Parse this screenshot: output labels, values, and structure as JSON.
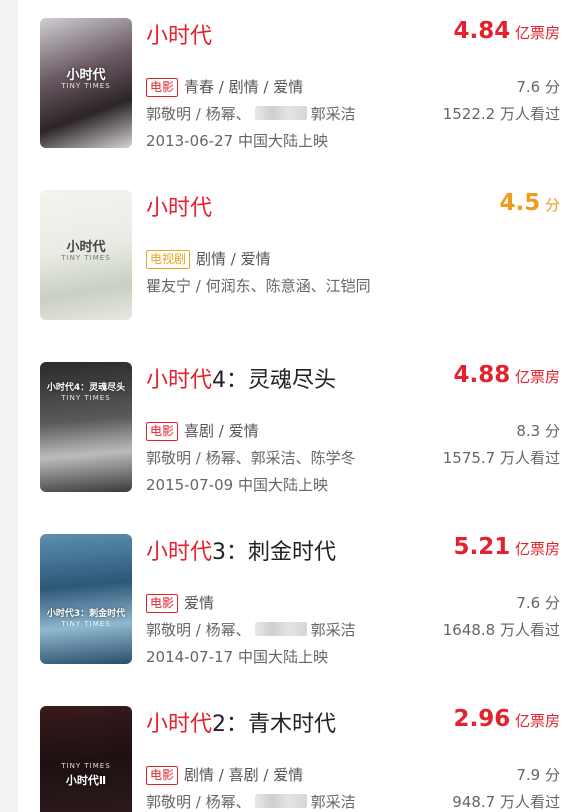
{
  "colors": {
    "accent_red": "#e2222e",
    "accent_orange": "#f29a1d",
    "tag_orange": "#e8a31f"
  },
  "items": [
    {
      "title_brand": "小时代",
      "title_rest": "",
      "figure_value": "4.84",
      "figure_unit": "亿票房",
      "tag": "电影",
      "genres": "青春 / 剧情 / 爱情",
      "cast_a": "郭敬明 / 杨幂、",
      "cast_b": "郭采洁",
      "release": "2013-06-27 中国大陆上映",
      "score": "7.6 分",
      "watched": "1522.2 万人看过",
      "poster_title": "小时代",
      "poster_sub": "TINY TIMES"
    },
    {
      "title_brand": "小时代",
      "title_rest": "",
      "figure_value": "4.5",
      "figure_unit": "分",
      "tag": "电视剧",
      "genres": "剧情 / 爱情",
      "cast": "瞿友宁 / 何润东、陈意涵、江铠同",
      "poster_title": "小时代",
      "poster_sub": "TINY TIMES"
    },
    {
      "title_brand": "小时代",
      "title_rest": "4：灵魂尽头",
      "figure_value": "4.88",
      "figure_unit": "亿票房",
      "tag": "电影",
      "genres": "喜剧 / 爱情",
      "cast": "郭敬明 / 杨幂、郭采洁、陈学冬",
      "release": "2015-07-09 中国大陆上映",
      "score": "8.3 分",
      "watched": "1575.7 万人看过",
      "poster_title": "小时代4：灵魂尽头",
      "poster_sub": "TINY TIMES"
    },
    {
      "title_brand": "小时代",
      "title_rest": "3：刺金时代",
      "figure_value": "5.21",
      "figure_unit": "亿票房",
      "tag": "电影",
      "genres": "爱情",
      "cast_a": "郭敬明 / 杨幂、",
      "cast_b": "郭采洁",
      "release": "2014-07-17 中国大陆上映",
      "score": "7.6 分",
      "watched": "1648.8 万人看过",
      "poster_title": "小时代3：刺金时代",
      "poster_sub": "TINY TIMES"
    },
    {
      "title_brand": "小时代",
      "title_rest": "2：青木时代",
      "figure_value": "2.96",
      "figure_unit": "亿票房",
      "tag": "电影",
      "genres": "剧情 / 喜剧 / 爱情",
      "cast_a": "郭敬明 / 杨幂、",
      "cast_b": "郭采洁",
      "score": "7.9 分",
      "watched": "948.7 万人看过",
      "poster_title": "小时代Ⅱ",
      "poster_sub": "TINY TIMES"
    }
  ]
}
